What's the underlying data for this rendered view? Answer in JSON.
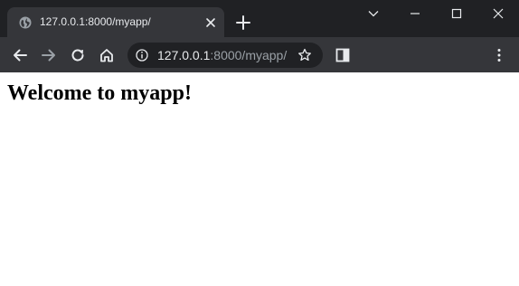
{
  "tab": {
    "title": "127.0.0.1:8000/myapp/",
    "favicon_icon": "globe-icon",
    "close_icon": "close-icon"
  },
  "window_controls": {
    "tab_search_icon": "chevron-down-icon",
    "minimize_icon": "minimize-icon",
    "maximize_icon": "maximize-icon",
    "close_icon": "close-icon"
  },
  "toolbar": {
    "back_icon": "arrow-left-icon",
    "forward_icon": "arrow-right-icon",
    "reload_icon": "reload-icon",
    "home_icon": "home-icon",
    "sidepanel_icon": "side-panel-icon",
    "menu_icon": "kebab-menu-icon"
  },
  "omnibox": {
    "info_icon": "info-icon",
    "url_host": "127.0.0.1",
    "url_rest": ":8000/myapp/",
    "bookmark_icon": "star-icon"
  },
  "page": {
    "heading": "Welcome to myapp!"
  },
  "colors": {
    "titlebar": "#202124",
    "toolbar": "#35363a",
    "omnibox": "#202124",
    "url_host": "#e8eaed",
    "url_rest": "#9aa0a6",
    "page_background": "#ffffff",
    "heading": "#000000"
  }
}
